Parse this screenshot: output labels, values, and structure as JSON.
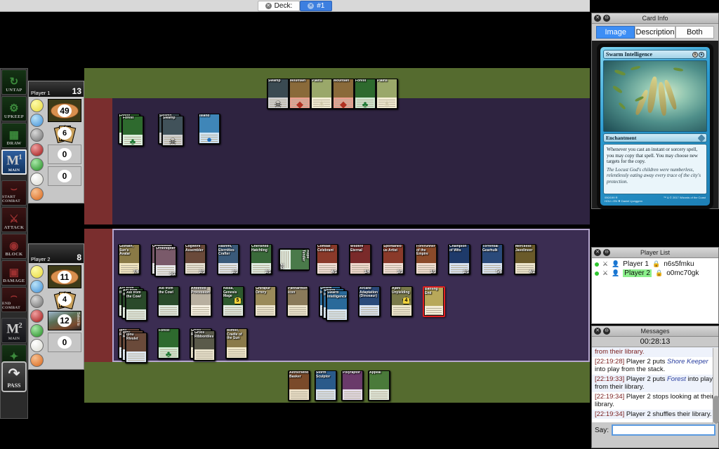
{
  "tabbar": {
    "deck_label": "Deck:",
    "tab1_label": "#1"
  },
  "phases": [
    {
      "name": "UNTAP",
      "icon": "untap-arrow-icon",
      "style": "g",
      "selected": false
    },
    {
      "name": "UPKEEP",
      "icon": "gear-icon",
      "style": "g",
      "selected": false
    },
    {
      "name": "DRAW",
      "icon": "card-draw-icon",
      "style": "g",
      "selected": false
    },
    {
      "name": "MAIN",
      "sup": "1",
      "icon": "main-phase-icon",
      "style": "b",
      "selected": true
    },
    {
      "name": "START COMBAT",
      "icon": "arc-icon",
      "style": "r",
      "selected": false
    },
    {
      "name": "ATTACK",
      "icon": "sword-icon",
      "style": "r",
      "selected": false
    },
    {
      "name": "BLOCK",
      "icon": "shield-icon",
      "style": "r",
      "selected": false
    },
    {
      "name": "DAMAGE",
      "icon": "tombstone-icon",
      "style": "r",
      "selected": false
    },
    {
      "name": "END COMBAT",
      "icon": "arc-icon",
      "style": "r",
      "selected": false
    },
    {
      "name": "MAIN",
      "sup": "2",
      "icon": "main-phase-icon",
      "style": "b",
      "selected": false
    },
    {
      "name": "END",
      "icon": "broom-icon",
      "style": "g",
      "selected": false
    }
  ],
  "pass_button": {
    "label": "PASS",
    "icon": "pass-arrow-icon"
  },
  "player1": {
    "name": "Player 1",
    "life": "13",
    "library": "49",
    "hand": "6",
    "graveyard": "0",
    "exile": "0",
    "mana": [
      "#f2e85c",
      "#5aa8e8",
      "#8c8c8c",
      "#b62020",
      "#2e9e2e",
      "#f2f2ee",
      "#e87a2e"
    ]
  },
  "player2": {
    "name": "Player 2",
    "life": "8",
    "library": "11",
    "hand": "4",
    "graveyard": "12",
    "graveyard_side_label": "Select to",
    "exile": "0",
    "mana": [
      "#f2e85c",
      "#5aa8e8",
      "#8c8c8c",
      "#b62020",
      "#2e9e2e",
      "#f2f2ee",
      "#e87a2e"
    ]
  },
  "p1_lands": [
    {
      "title": "Swamp",
      "art": "#3a4a52",
      "sym": "☠",
      "symcolor": "#111",
      "box": "#cfcfcf"
    },
    {
      "title": "Mountain",
      "art": "#8a6a3a",
      "sym": "◆",
      "symcolor": "#b03020",
      "box": "#e8a090"
    },
    {
      "title": "Plains",
      "art": "#9aa86a",
      "sym": "☀",
      "symcolor": "#cfc8a8",
      "box": "#f4eed4"
    },
    {
      "title": "Mountain",
      "art": "#8a6a3a",
      "sym": "◆",
      "symcolor": "#b03020",
      "box": "#e8a090"
    },
    {
      "title": "Forest",
      "art": "#2e6a2e",
      "sym": "♣",
      "symcolor": "#1f7a35",
      "box": "#cfe8cf"
    },
    {
      "title": "Plains",
      "art": "#9aa86a",
      "sym": "☀",
      "symcolor": "#cfc8a8",
      "box": "#f4eed4"
    }
  ],
  "p1_nonlands": [
    {
      "title": "Forest",
      "art": "#2e6a2e",
      "sym": "♣",
      "symcolor": "#1f7a35",
      "box": "#dbeedb",
      "stack": 2
    },
    {
      "title": "Swamp",
      "art": "#41525a",
      "sym": "☠",
      "symcolor": "#111",
      "box": "#cfcfcf",
      "stack": 2
    },
    {
      "title": "Island",
      "art": "#3f86b8",
      "sym": "●",
      "symcolor": "#1f70c0",
      "box": "#cfe4f4",
      "stack": 1
    }
  ],
  "p2_creatures": [
    {
      "title": "Gishath, Sun's Avatar",
      "pt": "7/6",
      "art": "#8a7a46",
      "box": "#efe4c0"
    },
    {
      "title": "Ornithopter",
      "pt": "0/2",
      "art": "#7a5a6a",
      "box": "#e8e8ea",
      "stack": 2
    },
    {
      "title": "Cogwork Assembler",
      "pt": "2/3",
      "art": "#6a4a3a",
      "box": "#e4ded0"
    },
    {
      "title": "Rashmi, Eternities Crafter",
      "pt": "2/3",
      "art": "#3a5a7a",
      "box": "#e0e4ea"
    },
    {
      "title": "Cherished Hatchling",
      "pt": "2/1",
      "art": "#3a6a3a",
      "box": "#dfeadf"
    },
    {
      "title": "Hope Tender",
      "pt": "2/2",
      "art": "#4a7a4a",
      "box": "#dfeadf",
      "tapped": true
    },
    {
      "title": "Combat Celebrant",
      "pt": "4/1",
      "art": "#8a3a2a",
      "box": "#f0dcd4"
    },
    {
      "title": "Wildfire Eternal",
      "pt": "1/4",
      "art": "#7a2a2a",
      "box": "#eed6cc"
    },
    {
      "title": "Spontaneous Artist",
      "pt": "3/3",
      "art": "#8a3a2a",
      "box": "#f0dcd4"
    },
    {
      "title": "Forerunner of the Empire",
      "pt": "1/3",
      "art": "#8a4a2a",
      "box": "#f0dcd0"
    },
    {
      "title": "Champion of Wits",
      "pt": "2/1",
      "art": "#1e3a6a",
      "box": "#d8e2f0"
    },
    {
      "title": "Torrential Gearhulk",
      "pt": "5/6",
      "art": "#2a4a7a",
      "box": "#d8e2f0"
    },
    {
      "title": "Merciless Javelineer",
      "pt": "4/2",
      "art": "#6a5a2a",
      "box": "#ece4cc"
    }
  ],
  "p2_enchantments": [
    {
      "title": "Aid from the Cowl",
      "art": "#2a4a2a",
      "box": "#dfe9df",
      "stack": 3
    },
    {
      "title": "Aid from the Cowl",
      "art": "#2a4a2a",
      "box": "#dfe9df"
    },
    {
      "title": "Anointed Procession",
      "art": "#b8b0a0",
      "box": "#f4efe0"
    },
    {
      "title": "Nissa, Genesis Mage",
      "art": "#2e5a2e",
      "box": "#dfe9df",
      "loyalty": "5"
    },
    {
      "title": "Ghirapur Orrery",
      "art": "#9a8a5a",
      "box": "#ece4cc"
    },
    {
      "title": "Panharmonicon",
      "art": "#8a7a5a",
      "box": "#ece4cc"
    },
    {
      "title": "Swarm Intelligence",
      "art": "#2a6a9a",
      "box": "#d8e6f2",
      "stack": 3
    },
    {
      "title": "Arcane Adaptation (Dinosaur)",
      "art": "#2a4a7a",
      "box": "#d8e2f0"
    },
    {
      "title": "Ajani Unyielding",
      "art": "#7a7a4a",
      "box": "#ede6cc",
      "loyalty": "4"
    },
    {
      "title": "Baffling End",
      "art": "#b8a85a",
      "box": "#f2ecd6",
      "selected": true
    }
  ],
  "p2_lands": [
    {
      "title": "Ipnu Rivulet",
      "art": "#6a4a3a",
      "box": "#dde6f0",
      "stack": 3
    },
    {
      "title": "Forest",
      "art": "#2e6a2e",
      "sym": "♣",
      "symcolor": "#1f7a35",
      "box": "#cfe8cf"
    },
    {
      "title": "Grixis Ribbontiles",
      "art": "#5a5a4a",
      "box": "#e8e2cc",
      "stack": 2
    },
    {
      "title": "Itlimoc, Cradle of the Sun",
      "art": "#8a7a4a",
      "box": "#efe6c8"
    }
  ],
  "p2_hand": [
    {
      "title": "Aetherwind Basker",
      "art": "#7a4a2a",
      "box": "#ece0c8"
    },
    {
      "title": "Storm Sculptor",
      "art": "#2a5a8a",
      "box": "#d8e2f0"
    },
    {
      "title": "Polyraptor",
      "art": "#6a3a6a",
      "box": "#e6dcea"
    },
    {
      "title": "Appeal",
      "art": "#4a7a3a",
      "box": "#e2eadc"
    }
  ],
  "cardinfo": {
    "window_title": "Card Info",
    "tabs": [
      "Image",
      "Description",
      "Both"
    ],
    "active_tab": "Image",
    "card": {
      "name": "Swarm Intelligence",
      "cost": [
        "6",
        "U"
      ],
      "type": "Enchantment",
      "rules": "Whenever you cast an instant or sorcery spell, you may copy that spell. You may choose new targets for the copy.",
      "flavor": "The Locust God's children were numberless, relentlessly eating away every trace of the city's protection.",
      "collector": "050/199 R",
      "setline": "HOU • EN ❖ Daniel Ljunggren",
      "copyright": "™ & © 2017 Wizards of the Coast"
    }
  },
  "playerlist": {
    "window_title": "Player List",
    "rows": [
      {
        "name": "Player 1",
        "id": "n6s5fmku",
        "highlight": false
      },
      {
        "name": "Player 2",
        "id": "o0mc70gk",
        "highlight": true
      }
    ]
  },
  "messages": {
    "window_title": "Messages",
    "clock": "00:28:13",
    "lines": [
      {
        "text": "from their library.",
        "partial": true
      },
      {
        "time": "[22:19:28]",
        "pre": " Player 2 puts ",
        "em": "Shore Keeper",
        "post": " into play from the stack."
      },
      {
        "time": "[22:19:33]",
        "pre": " Player 2 puts ",
        "em": "Forest",
        "post": " into play from their library."
      },
      {
        "time": "[22:19:34]",
        "pre": " Player 2 stops looking at their library.",
        "em": "",
        "post": ""
      },
      {
        "time": "[22:19:34]",
        "pre": " Player 2 shuffles their library.",
        "em": "",
        "post": ""
      }
    ],
    "say_label": "Say:",
    "say_value": "",
    "say_placeholder": ""
  }
}
